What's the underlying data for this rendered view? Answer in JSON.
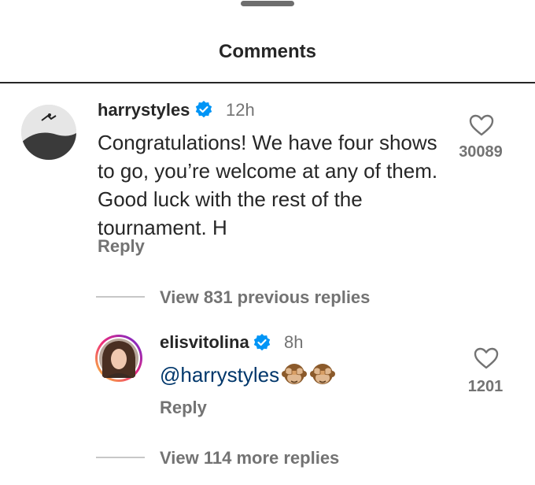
{
  "header": {
    "title": "Comments"
  },
  "comment": {
    "username": "harrystyles",
    "time": "12h",
    "text": "Congratulations! We have four shows to go, you’re welcome at any of them. Good luck with the rest of the tournament. H",
    "reply_label": "Reply",
    "likes": "30089",
    "view_previous_label": "View 831 previous replies"
  },
  "reply": {
    "username": "elisvitolina",
    "time": "8h",
    "mention": "@harrystyles",
    "emojis": [
      "see-no-evil-monkey",
      "see-no-evil-monkey"
    ],
    "reply_label": "Reply",
    "likes": "1201",
    "view_more_label": "View 114 more replies"
  },
  "colors": {
    "verified": "#0095f6",
    "text": "#262626",
    "muted": "#737373",
    "mention": "#00376b"
  }
}
